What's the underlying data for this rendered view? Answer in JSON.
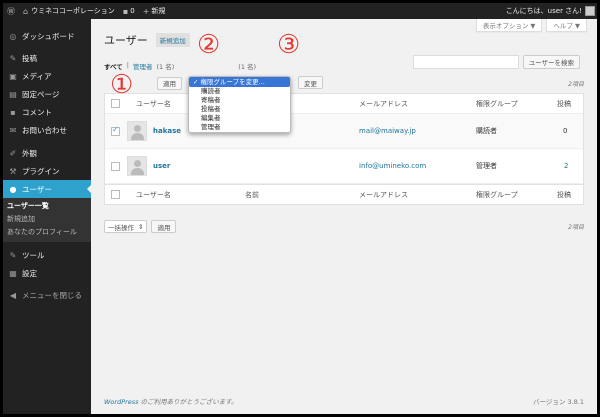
{
  "admin_bar": {
    "site_name": "ウミネココーポレーション",
    "comments_count": "0",
    "new_label": "新規",
    "greeting": "こんにちは、user さん!"
  },
  "sidebar": {
    "items": [
      {
        "label": "ダッシュボード",
        "icon": "dashboard-icon"
      },
      {
        "label": "投稿",
        "icon": "pin-icon"
      },
      {
        "label": "メディア",
        "icon": "media-icon"
      },
      {
        "label": "固定ページ",
        "icon": "page-icon"
      },
      {
        "label": "コメント",
        "icon": "comment-icon"
      },
      {
        "label": "お問い合わせ",
        "icon": "mail-icon"
      },
      {
        "label": "外観",
        "icon": "brush-icon"
      },
      {
        "label": "プラグイン",
        "icon": "plugin-icon"
      },
      {
        "label": "ユーザー",
        "icon": "user-icon"
      },
      {
        "label": "ツール",
        "icon": "wrench-icon"
      },
      {
        "label": "設定",
        "icon": "settings-icon"
      }
    ],
    "submenu": [
      "ユーザー一覧",
      "新規追加",
      "あなたのプロフィール"
    ],
    "collapse_label": "メニューを閉じる"
  },
  "screen_tabs": {
    "screen_options": "表示オプション ▼",
    "help": "ヘルプ ▼"
  },
  "page": {
    "title": "ユーザー",
    "add_new": "新規追加"
  },
  "filters": {
    "all": "すべて",
    "admin": "管理者",
    "admin_count": "(1 名)",
    "subscriber_count": "(1 名)",
    "sep": "|"
  },
  "search": {
    "button": "ユーザーを検索"
  },
  "bulk": {
    "apply": "適用",
    "change_role": "権限グループを変更...",
    "change": "変更",
    "bulk_actions": "一括操作",
    "items_count": "2項目"
  },
  "role_options": [
    "購読者",
    "寄稿者",
    "投稿者",
    "編集者",
    "管理者"
  ],
  "table": {
    "columns": [
      "ユーザー名",
      "名前",
      "メールアドレス",
      "権限グループ",
      "投稿"
    ],
    "rows": [
      {
        "username": "hakase",
        "name": "",
        "email": "mail@maiway.jp",
        "role": "購読者",
        "posts": "0",
        "checked": true
      },
      {
        "username": "user",
        "name": "",
        "email": "info@umineko.com",
        "role": "管理者",
        "posts": "2",
        "checked": false
      }
    ]
  },
  "markers": [
    "①",
    "②",
    "③"
  ],
  "footer": {
    "credit_link": "WordPress",
    "credit_text": " のご利用ありがとうございます。",
    "version": "バージョン 3.8.1"
  },
  "colors": {
    "accent": "#2ea2cc",
    "marker": "#e23b35",
    "link": "#21759b"
  }
}
